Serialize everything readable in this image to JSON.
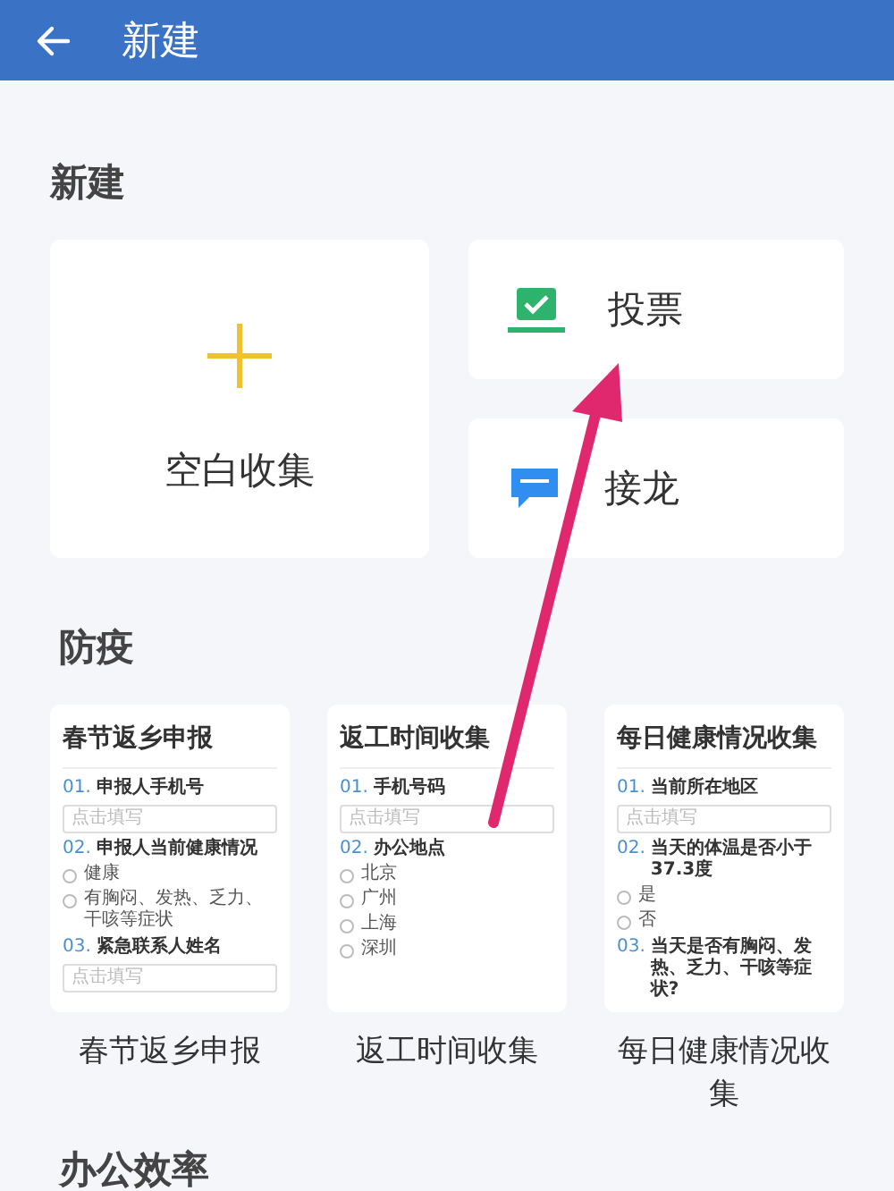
{
  "header": {
    "title": "新建"
  },
  "create": {
    "title": "新建",
    "blank": {
      "label": "空白收集"
    },
    "cards": [
      {
        "kind": "vote",
        "label": "投票"
      },
      {
        "kind": "relay",
        "label": "接龙"
      }
    ]
  },
  "epidemic": {
    "title": "防疫",
    "templates": [
      {
        "title": "春节返乡申报",
        "caption": "春节返乡申报",
        "questions": [
          {
            "number": "01.",
            "text": "申报人手机号",
            "kind": "input",
            "placeholder": "点击填写"
          },
          {
            "number": "02.",
            "text": "申报人当前健康情况",
            "kind": "choice",
            "options": [
              "健康",
              "有胸闷、发热、乏力、干咳等症状"
            ]
          },
          {
            "number": "03.",
            "text": "紧急联系人姓名",
            "kind": "input",
            "placeholder": "点击填写"
          }
        ]
      },
      {
        "title": "返工时间收集",
        "caption": "返工时间收集",
        "questions": [
          {
            "number": "01.",
            "text": "手机号码",
            "kind": "input",
            "placeholder": "点击填写"
          },
          {
            "number": "02.",
            "text": "办公地点",
            "kind": "choice",
            "options": [
              "北京",
              "广州",
              "上海",
              "深圳"
            ]
          }
        ]
      },
      {
        "title": "每日健康情况收集",
        "caption": "每日健康情况收集",
        "questions": [
          {
            "number": "01.",
            "text": "当前所在地区",
            "kind": "input",
            "placeholder": "点击填写"
          },
          {
            "number": "02.",
            "text": "当天的体温是否小于37.3度",
            "kind": "choice",
            "options": [
              "是",
              "否"
            ]
          },
          {
            "number": "03.",
            "text": "当天是否有胸闷、发热、乏力、干咳等症状?",
            "kind": "text"
          }
        ]
      }
    ]
  },
  "next_section": {
    "title": "办公效率"
  }
}
